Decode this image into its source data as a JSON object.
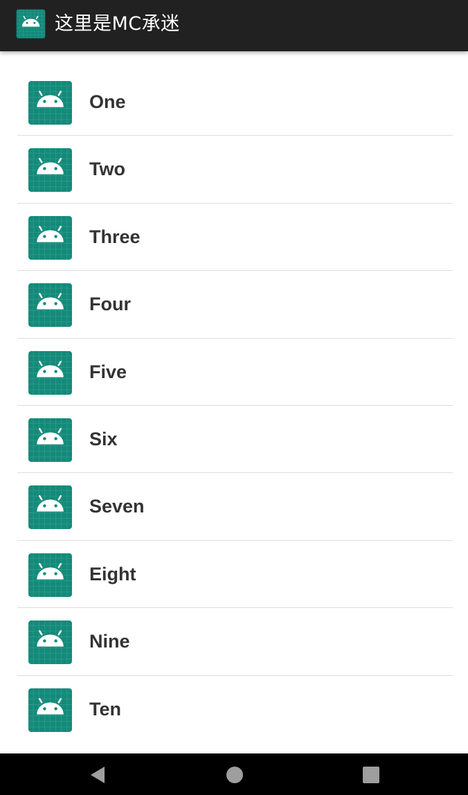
{
  "app": {
    "title": "这里是MC承迷",
    "icon": "android-launcher-icon"
  },
  "colors": {
    "appbar": "#212121",
    "icon_bg": "#138a7a",
    "icon_grid": "#3aa090",
    "label": "#333333",
    "divider": "#dddddd"
  },
  "list": {
    "items": [
      {
        "label": "One",
        "icon": "android-launcher-icon"
      },
      {
        "label": "Two",
        "icon": "android-launcher-icon"
      },
      {
        "label": "Three",
        "icon": "android-launcher-icon"
      },
      {
        "label": "Four",
        "icon": "android-launcher-icon"
      },
      {
        "label": "Five",
        "icon": "android-launcher-icon"
      },
      {
        "label": "Six",
        "icon": "android-launcher-icon"
      },
      {
        "label": "Seven",
        "icon": "android-launcher-icon"
      },
      {
        "label": "Eight",
        "icon": "android-launcher-icon"
      },
      {
        "label": "Nine",
        "icon": "android-launcher-icon"
      },
      {
        "label": "Ten",
        "icon": "android-launcher-icon"
      }
    ]
  },
  "navbar": {
    "buttons": [
      "back-icon",
      "home-icon",
      "recents-icon"
    ]
  }
}
